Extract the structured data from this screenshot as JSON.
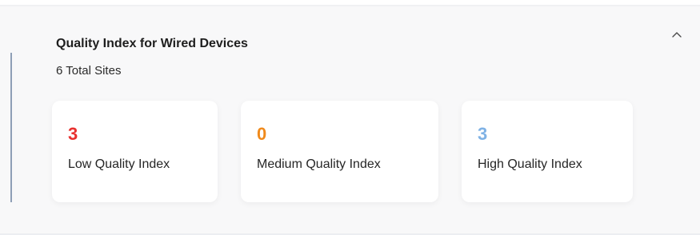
{
  "section": {
    "title": "Quality Index for Wired Devices",
    "subtitle": "6 Total Sites",
    "collapse_icon": "chevron-up-icon"
  },
  "cards": [
    {
      "value": "3",
      "label": "Low Quality Index",
      "color": "#e8312f"
    },
    {
      "value": "0",
      "label": "Medium Quality Index",
      "color": "#f08a1c"
    },
    {
      "value": "3",
      "label": "High Quality Index",
      "color": "#7fb2e5"
    }
  ],
  "colors": {
    "panel_background": "#f8f8f9",
    "accent_bar": "#8e9fb6"
  }
}
